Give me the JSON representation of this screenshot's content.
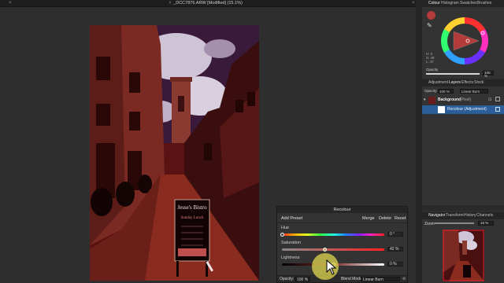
{
  "document": {
    "title": "_DCC7876.ARW [Modified] (15.1%)"
  },
  "recolour": {
    "title": "Recolour",
    "add_preset": "Add Preset",
    "merge": "Merge",
    "delete": "Delete",
    "reset": "Reset",
    "hue_label": "Hue",
    "hue_value": "0 °",
    "saturation_label": "Saturation",
    "saturation_value": "42 %",
    "lightness_label": "Lightness",
    "lightness_value": "0 %",
    "opacity_label": "Opacity:",
    "opacity_value": "100 %",
    "blend_label": "Blend Mode:",
    "blend_value": "Linear Burn",
    "hue_level": 0.0,
    "saturation_level": 0.42,
    "lightness_level": 0.5
  },
  "colour_panel": {
    "tabs": [
      "Colour",
      "Histogram",
      "Swatches",
      "Brushes"
    ],
    "hsl": [
      "H: 0",
      "S: 48",
      "L: 37"
    ],
    "opacity_label": "Opacity",
    "opacity_value": "100 %",
    "accent": "#b53a3a"
  },
  "layers_panel": {
    "tabs": [
      "Adjustment",
      "Layers",
      "Effects",
      "Stock"
    ],
    "opacity_label": "Opacity:",
    "opacity_value": "100 %",
    "blend_value": "Linear Burn",
    "layers": [
      {
        "name": "Background",
        "kind": "(Pixel)"
      },
      {
        "name": "Recolour (Adjustment)",
        "kind": ""
      }
    ]
  },
  "navigator_panel": {
    "tabs": [
      "Navigator",
      "Transform",
      "History",
      "Channels"
    ],
    "zoom_label": "Zoom",
    "zoom_value": "15 %"
  },
  "photo": {
    "sign_title": "Jesse's Bistro",
    "sign_line": "Sunday Lunch"
  }
}
